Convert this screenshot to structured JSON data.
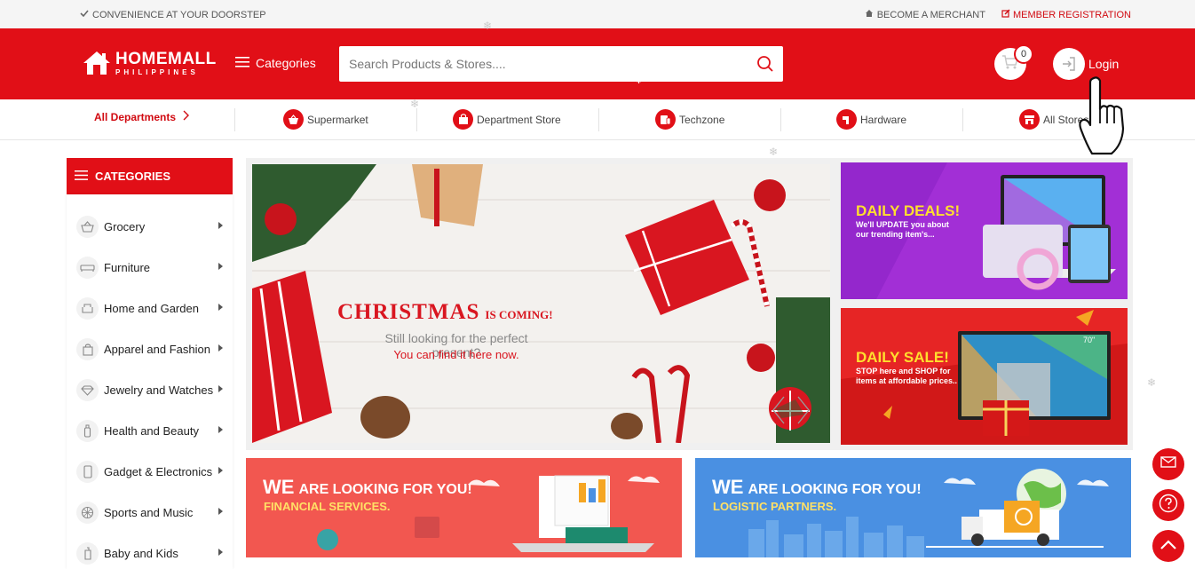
{
  "topbar": {
    "tagline": "CONVENIENCE AT YOUR DOORSTEP",
    "merchant_label": "BECOME A MERCHANT",
    "member_label": "MEMBER REGISTRATION"
  },
  "header": {
    "logo_primary": "HOMEMALL",
    "logo_secondary": "PHILIPPINES",
    "categories_label": "Categories",
    "search_placeholder": "Search Products & Stores....",
    "cart_count": "0",
    "login_label": "Login"
  },
  "departments": {
    "all_label": "All Departments",
    "items": [
      {
        "label": "Supermarket",
        "icon": "basket-icon"
      },
      {
        "label": "Department Store",
        "icon": "shopping-bag-icon"
      },
      {
        "label": "Techzone",
        "icon": "devices-icon"
      },
      {
        "label": "Hardware",
        "icon": "tools-icon"
      },
      {
        "label": "All Stores",
        "icon": "store-icon"
      }
    ]
  },
  "sidebar": {
    "title": "CATEGORIES",
    "items": [
      {
        "label": "Grocery",
        "icon": "basket-icon"
      },
      {
        "label": "Furniture",
        "icon": "sofa-icon"
      },
      {
        "label": "Home and Garden",
        "icon": "armchair-icon"
      },
      {
        "label": "Apparel and Fashion",
        "icon": "bag-icon"
      },
      {
        "label": "Jewelry and Watches",
        "icon": "diamond-icon"
      },
      {
        "label": "Health and Beauty",
        "icon": "bottle-icon"
      },
      {
        "label": "Gadget & Electronics",
        "icon": "phone-icon"
      },
      {
        "label": "Sports and Music",
        "icon": "ball-icon"
      },
      {
        "label": "Baby and Kids",
        "icon": "baby-bottle-icon"
      }
    ]
  },
  "hero": {
    "headline": "CHRISTMAS",
    "headline_suffix": "IS COMING!",
    "line1": "Still looking for the perfect present?",
    "line2": "You can find it here now."
  },
  "banners": {
    "deals_title": "DAILY DEALS!",
    "deals_sub1": "We'll UPDATE you about",
    "deals_sub2": "our trending item's...",
    "sale_title": "DAILY SALE!",
    "sale_sub1": "STOP here and SHOP for",
    "sale_sub2": "items at affordable prices..",
    "tv_size": "70\"",
    "financial_title_1": "WE",
    "financial_title_2": "ARE LOOKING FOR YOU!",
    "financial_sub": "FINANCIAL SERVICES.",
    "logistic_title_1": "WE",
    "logistic_title_2": "ARE LOOKING FOR YOU!",
    "logistic_sub": "LOGISTIC PARTNERS."
  },
  "colors": {
    "brand_red": "#e10f17",
    "deals_purple": "#9b2bd8",
    "financial_coral": "#f25750",
    "logistic_blue": "#4a90e2"
  }
}
